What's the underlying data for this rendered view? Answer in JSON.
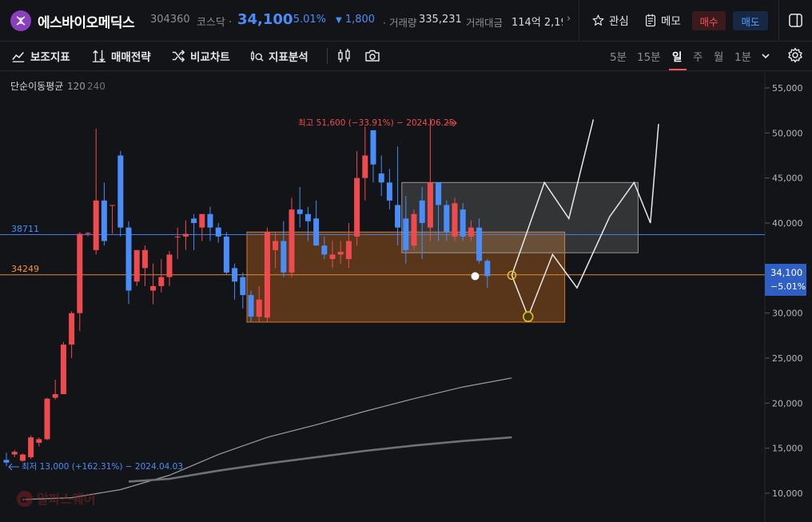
{
  "header": {
    "name": "에스바이오메딕스",
    "code": "304360",
    "market": "코스닥 ·",
    "price": "34,100",
    "change_pct": "-5.01%",
    "change_arrow": "▼",
    "change_value": "1,800",
    "volume_label": "· 거래량",
    "volume_value": "335,231",
    "amount_label": "거래대금",
    "amount_value": "114억 2,19",
    "more_arrow": "›",
    "fav_label": "관심",
    "memo_label": "메모",
    "buy_label": "매수",
    "sell_label": "매도"
  },
  "toolbar": {
    "indicators": "보조지표",
    "strategy": "매매전략",
    "compare": "비교차트",
    "analysis": "지표분석",
    "periods": [
      "5분",
      "15분",
      "일",
      "주",
      "월",
      "1분"
    ],
    "active_period": "일"
  },
  "colors": {
    "up": "#ef4b4f",
    "down": "#4a8df8",
    "background": "#131417",
    "ma120": "#9a9ca1",
    "ma240": "#6f7176"
  },
  "chart": {
    "legend_label": "단순이동평균",
    "legend_120": "120",
    "legend_240": "240",
    "hline_blue_label": "38711",
    "hline_orange_label": "34249",
    "hline_blue_value": 38711,
    "hline_orange_value": 34249,
    "high_annotation": "최고 51,600 (−33.91%) − 2024.06.25",
    "low_annotation": "최저 13,000 (+162.31%) − 2024.04.03",
    "last_price_label": "34,100",
    "last_pct_label": "−5.01%",
    "watermark": "알파스퀘어"
  },
  "chart_data": {
    "type": "candlestick",
    "yaxis_ticks": [
      "55,000",
      "50,000",
      "45,000",
      "40,000",
      "35,000",
      "30,000",
      "25,000",
      "20,000",
      "15,000",
      "10,000"
    ],
    "ylim": [
      7000,
      57000
    ],
    "last_price": 34100,
    "candles": [
      [
        13700,
        14500,
        13000,
        13400
      ],
      [
        14300,
        14800,
        14000,
        14600
      ],
      [
        13600,
        14400,
        13500,
        14300
      ],
      [
        14000,
        16400,
        13800,
        16200
      ],
      [
        15600,
        16200,
        15200,
        16000
      ],
      [
        16000,
        20600,
        15900,
        20500
      ],
      [
        20600,
        22600,
        20400,
        21000
      ],
      [
        21000,
        26800,
        21000,
        26500
      ],
      [
        26500,
        30200,
        25000,
        30000
      ],
      [
        30000,
        39000,
        28000,
        38800
      ],
      [
        38800,
        39000,
        38500,
        38900
      ],
      [
        37000,
        50500,
        36500,
        42500
      ],
      [
        42500,
        44500,
        37500,
        38000
      ],
      [
        42000,
        42000,
        38800,
        42000
      ],
      [
        47500,
        48000,
        38500,
        39500
      ],
      [
        39500,
        40200,
        31000,
        32500
      ],
      [
        33500,
        37000,
        33000,
        37000
      ],
      [
        35000,
        37500,
        33000,
        37000
      ],
      [
        32500,
        35500,
        31000,
        33000
      ],
      [
        33000,
        36000,
        32300,
        34000
      ],
      [
        34000,
        36900,
        33000,
        36500
      ],
      [
        38500,
        39500,
        36000,
        38500
      ],
      [
        38500,
        40300,
        37000,
        38800
      ],
      [
        40500,
        41000,
        37000,
        40000
      ],
      [
        39500,
        41000,
        38000,
        41000
      ],
      [
        41000,
        41800,
        38000,
        39500
      ],
      [
        39500,
        40000,
        37800,
        38500
      ],
      [
        38500,
        39000,
        34300,
        34500
      ],
      [
        35000,
        35500,
        31500,
        33500
      ],
      [
        34000,
        34500,
        30500,
        32000
      ],
      [
        32000,
        32500,
        29000,
        29600
      ],
      [
        29600,
        33000,
        29000,
        31500
      ],
      [
        29500,
        39500,
        29000,
        39000
      ],
      [
        37000,
        39000,
        35000,
        38000
      ],
      [
        38000,
        40200,
        34000,
        34500
      ],
      [
        34500,
        42800,
        34000,
        41500
      ],
      [
        41500,
        44000,
        39500,
        41000
      ],
      [
        41000,
        41800,
        38000,
        40200
      ],
      [
        40500,
        42500,
        38000,
        37500
      ],
      [
        37500,
        38500,
        36000,
        36500
      ],
      [
        36000,
        38000,
        35000,
        36500
      ],
      [
        36500,
        38000,
        35500,
        36800
      ],
      [
        36000,
        40000,
        35000,
        38000
      ],
      [
        38500,
        48000,
        37500,
        45000
      ],
      [
        45000,
        50700,
        42500,
        47500
      ],
      [
        50300,
        50300,
        44500,
        46500
      ],
      [
        45500,
        47500,
        43000,
        44500
      ],
      [
        44500,
        46000,
        41500,
        42500
      ],
      [
        42000,
        48500,
        37500,
        39500
      ],
      [
        40500,
        43000,
        35500,
        37000
      ],
      [
        37500,
        41500,
        37000,
        41000
      ],
      [
        42500,
        44000,
        36000,
        40000
      ],
      [
        39500,
        51600,
        38000,
        44500
      ],
      [
        44500,
        42500,
        38000,
        42000
      ],
      [
        42000,
        42500,
        38000,
        39000
      ],
      [
        38500,
        42800,
        38000,
        42200
      ],
      [
        41500,
        42200,
        38000,
        38500
      ],
      [
        38500,
        40300,
        38000,
        39500
      ],
      [
        39500,
        40500,
        35500,
        35800
      ],
      [
        35800,
        36000,
        32800,
        34100
      ]
    ],
    "ma120": [
      [
        2,
        9300
      ],
      [
        8,
        9500
      ],
      [
        14,
        10400
      ],
      [
        20,
        12000
      ],
      [
        26,
        14300
      ],
      [
        32,
        16200
      ],
      [
        38,
        17600
      ],
      [
        44,
        19100
      ],
      [
        50,
        20500
      ],
      [
        56,
        21800
      ],
      [
        62,
        22800
      ]
    ],
    "ma240": [
      [
        15,
        11300
      ],
      [
        20,
        11600
      ],
      [
        26,
        12500
      ],
      [
        32,
        13300
      ],
      [
        38,
        14000
      ],
      [
        44,
        14700
      ],
      [
        50,
        15300
      ],
      [
        56,
        15800
      ],
      [
        62,
        16200
      ]
    ],
    "zones": [
      {
        "name": "orange-zone",
        "from_index": 30,
        "to_index": 68,
        "top": 39000,
        "bottom": 29000
      },
      {
        "name": "gray-zone",
        "from_index": 49,
        "to_index": 77,
        "top": 44500,
        "bottom": 36700
      }
    ],
    "projection_line_1": [
      [
        62,
        34200
      ],
      [
        64,
        29600
      ],
      [
        67,
        36500
      ],
      [
        70,
        32800
      ],
      [
        74,
        40700
      ],
      [
        77,
        44500
      ],
      [
        79,
        40000
      ],
      [
        80,
        51000
      ]
    ],
    "projection_line_2": [
      [
        62,
        34200
      ],
      [
        66,
        44500
      ],
      [
        69,
        40500
      ],
      [
        72,
        51500
      ]
    ]
  }
}
